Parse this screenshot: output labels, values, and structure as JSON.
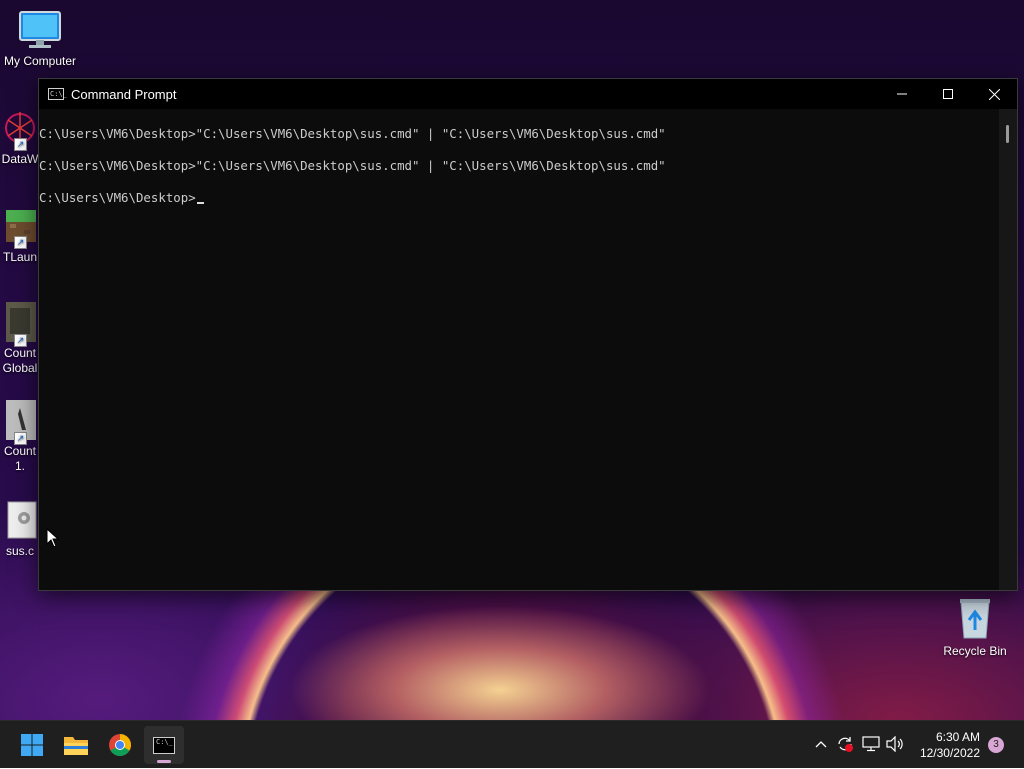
{
  "desktop": {
    "icons": [
      {
        "label": "My Computer"
      },
      {
        "label": "DataW"
      },
      {
        "label": "TLaun"
      },
      {
        "label": "Count",
        "label2": "Global"
      },
      {
        "label": "Count",
        "label2": "1."
      },
      {
        "label": "sus.c"
      }
    ],
    "recycle_bin": {
      "label": "Recycle Bin"
    }
  },
  "cmd_window": {
    "title": "Command Prompt",
    "lines": [
      "C:\\Users\\VM6\\Desktop>\"C:\\Users\\VM6\\Desktop\\sus.cmd\" | \"C:\\Users\\VM6\\Desktop\\sus.cmd\"",
      "C:\\Users\\VM6\\Desktop>\"C:\\Users\\VM6\\Desktop\\sus.cmd\" | \"C:\\Users\\VM6\\Desktop\\sus.cmd\""
    ],
    "prompt": "C:\\Users\\VM6\\Desktop>"
  },
  "taskbar": {
    "apps": [
      "start-icon",
      "file-explorer-icon",
      "chrome-icon",
      "command-prompt-icon"
    ],
    "clock": {
      "time": "6:30 AM",
      "date": "12/30/2022"
    },
    "notification_count": "3"
  }
}
